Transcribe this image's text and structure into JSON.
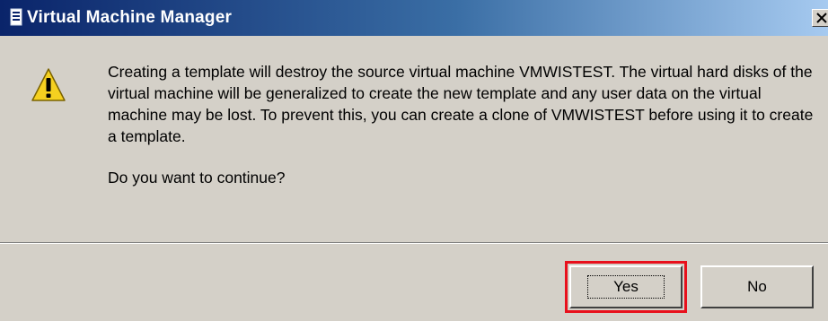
{
  "window": {
    "title": "Virtual Machine Manager",
    "close_label": "Close"
  },
  "dialog": {
    "message": "Creating a template will destroy the source virtual machine VMWISTEST. The virtual hard disks of the virtual machine will be generalized to create the new template and any user data on the virtual machine may be lost. To prevent this, you can create a clone of VMWISTEST before using it to create a template.",
    "question": "Do you want to continue?",
    "icon": "warning-icon"
  },
  "buttons": {
    "yes_label": "Yes",
    "no_label": "No"
  },
  "colors": {
    "highlight": "#e8101c",
    "titlebar": "#0a246a",
    "dialog_bg": "#d4d0c8"
  }
}
